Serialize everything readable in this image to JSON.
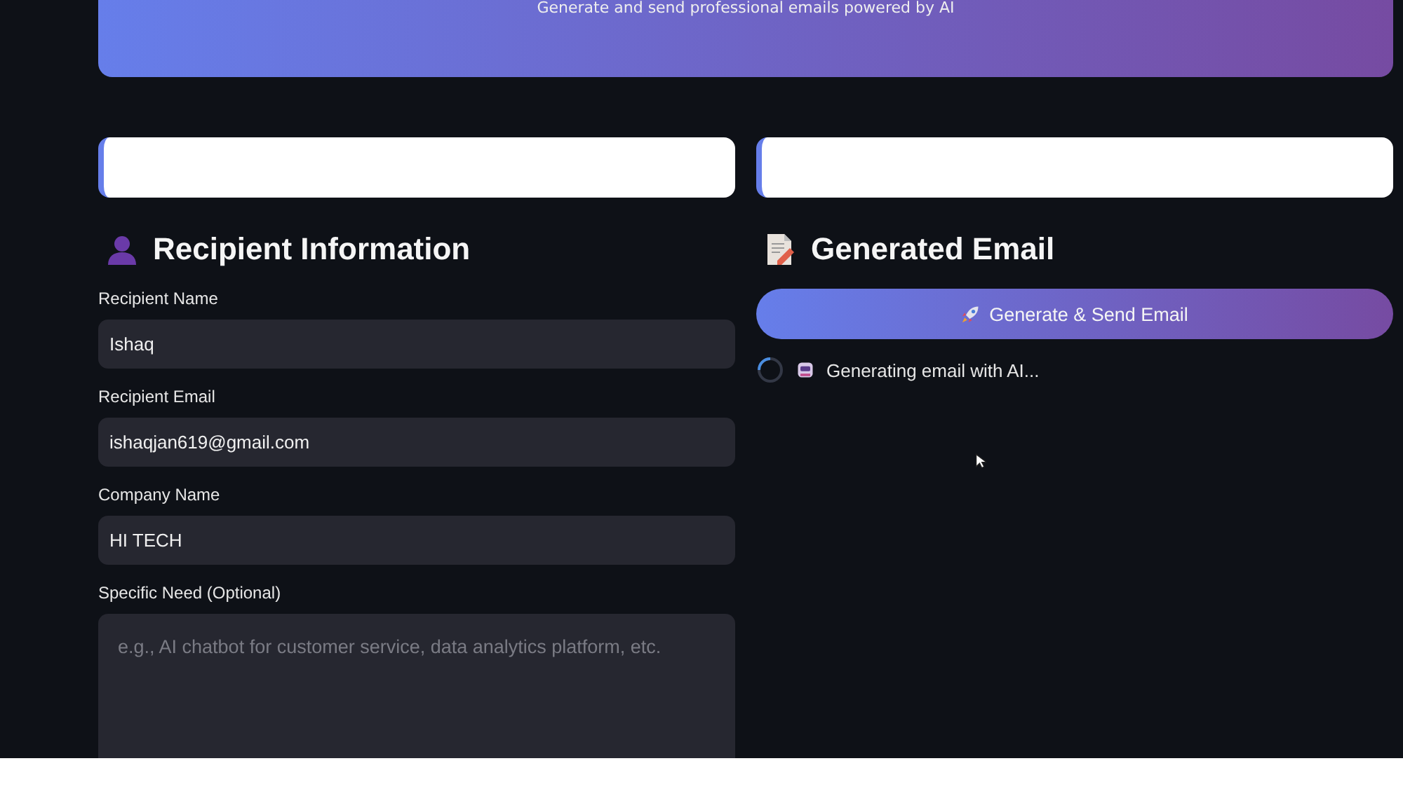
{
  "header": {
    "subtitle": "Generate and send professional emails powered by AI"
  },
  "left": {
    "title": "Recipient Information",
    "fields": [
      {
        "label": "Recipient Name",
        "kind": "input",
        "value": "Ishaq"
      },
      {
        "label": "Recipient Email",
        "kind": "input",
        "value": "ishaqjan619@gmail.com"
      },
      {
        "label": "Company Name",
        "kind": "input",
        "value": "HI TECH"
      },
      {
        "label": "Specific Need (Optional)",
        "kind": "textarea",
        "placeholder": "e.g., AI chatbot for customer service, data analytics platform, etc."
      }
    ]
  },
  "right": {
    "title": "Generated Email",
    "button": "Generate & Send Email",
    "status": "Generating email with AI..."
  }
}
